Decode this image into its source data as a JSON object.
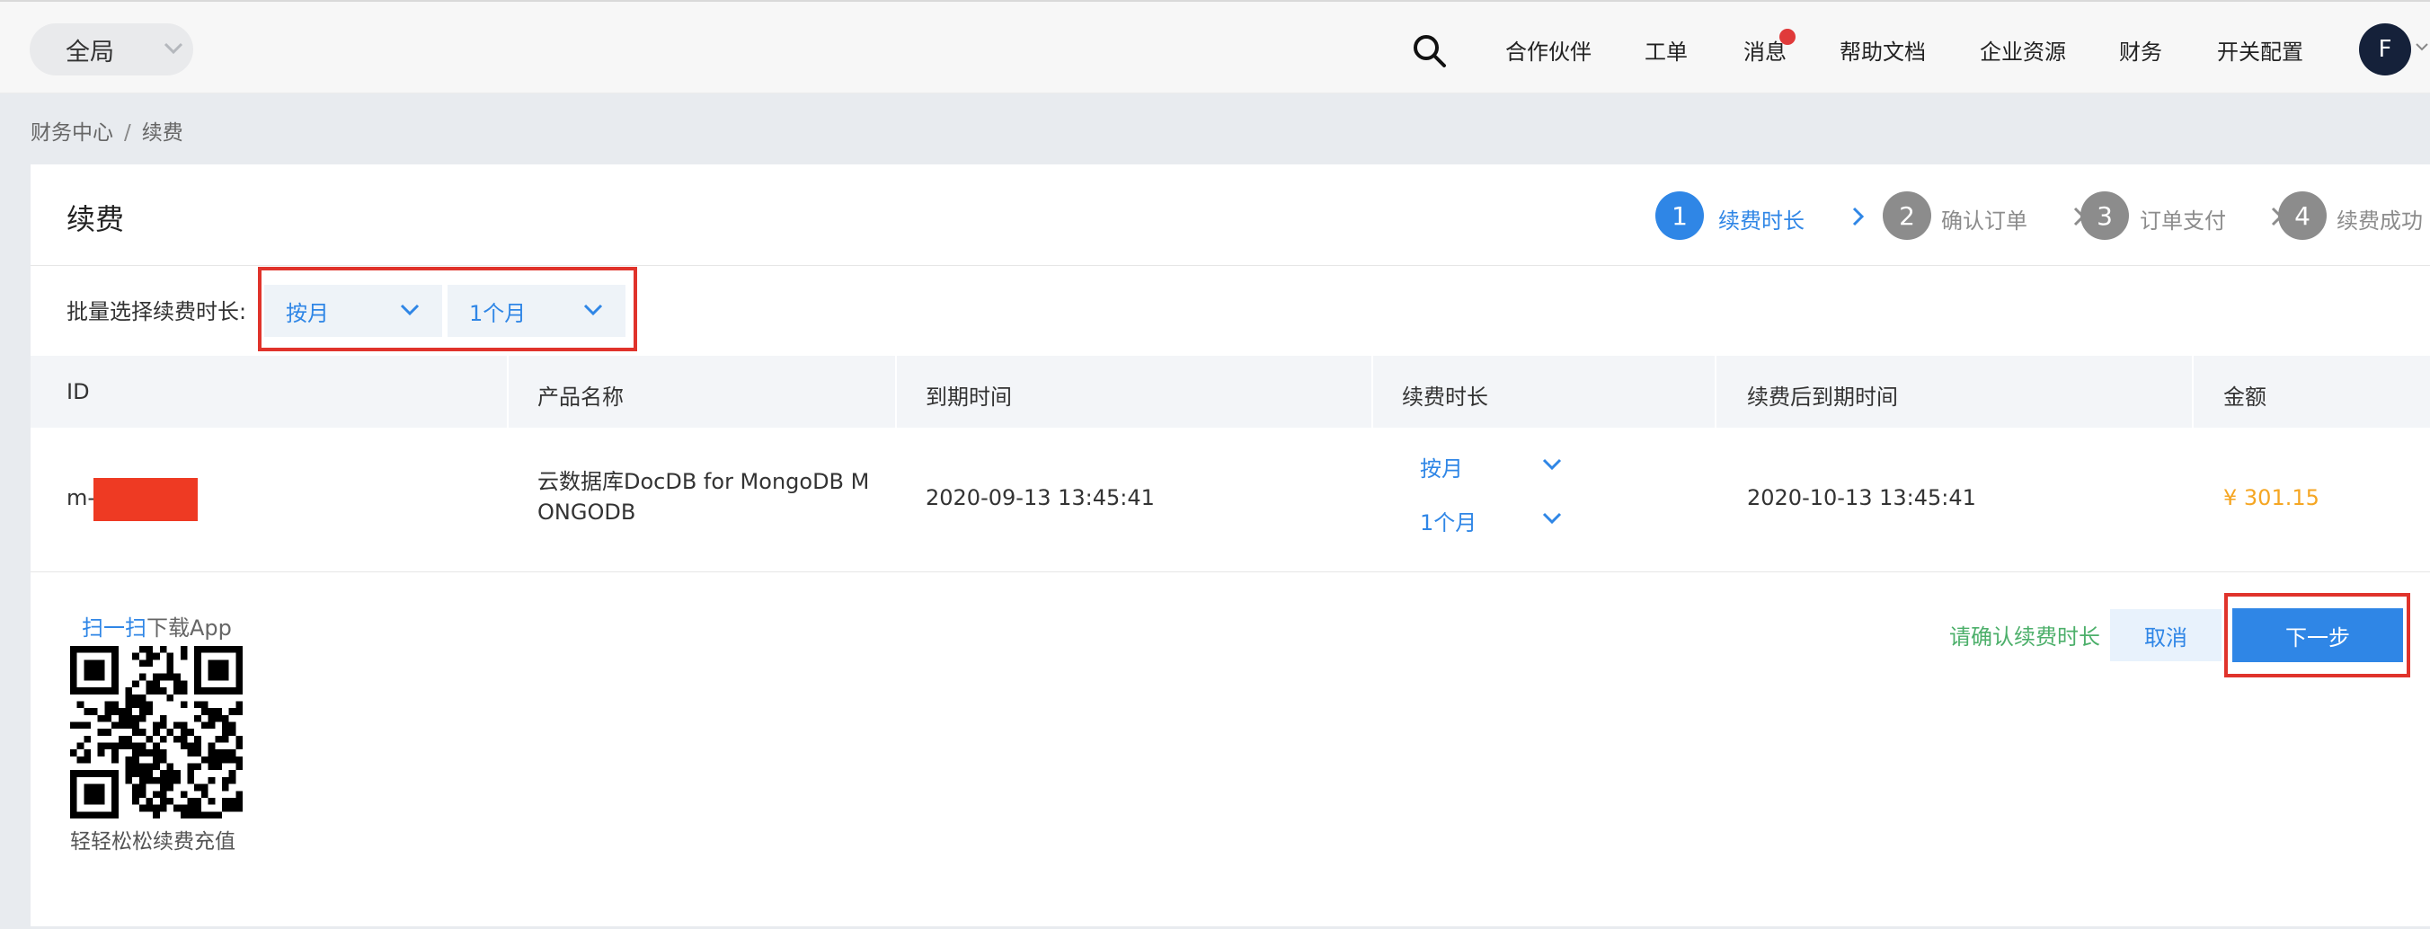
{
  "topbar": {
    "region": "全局",
    "nav": [
      "合作伙伴",
      "工单",
      "消息",
      "帮助文档",
      "企业资源",
      "财务",
      "开关配置"
    ],
    "avatar_initial": "F"
  },
  "breadcrumb": {
    "parent": "财务中心",
    "separator": "/",
    "current": "续费"
  },
  "page": {
    "title": "续费",
    "steps": [
      {
        "num": "1",
        "label": "续费时长",
        "state": "active"
      },
      {
        "num": "2",
        "label": "确认订单",
        "state": "inactive"
      },
      {
        "num": "3",
        "label": "订单支付",
        "state": "inactive"
      },
      {
        "num": "4",
        "label": "续费成功",
        "state": "inactive"
      }
    ]
  },
  "batch": {
    "label": "批量选择续费时长:",
    "unit_select": "按月",
    "duration_select": "1个月"
  },
  "table": {
    "headers": [
      "ID",
      "产品名称",
      "到期时间",
      "续费时长",
      "续费后到期时间",
      "金额"
    ],
    "rows": [
      {
        "id": "m-",
        "product_line1": "云数据库DocDB for MongoDB M",
        "product_line2": "ONGODB",
        "expire": "2020-09-13 13:45:41",
        "unit": "按月",
        "duration": "1个月",
        "new_expire": "2020-10-13 13:45:41",
        "amount": "¥ 301.15"
      }
    ]
  },
  "footer": {
    "qr_scan": "扫一扫",
    "qr_download": "下载App",
    "qr_caption": "轻轻松松续费充值",
    "confirm_note": "请确认续费时长",
    "cancel": "取消",
    "next": "下一步"
  },
  "colors": {
    "accent": "#2f86e6",
    "price": "#f5a623",
    "highlight_box": "#e0332b",
    "step_inactive": "#8c8c8c",
    "note_green": "#4caf6a"
  }
}
